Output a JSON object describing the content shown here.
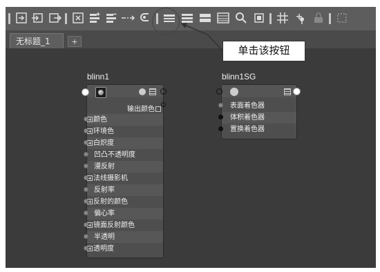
{
  "toolbar": {
    "icons": [
      "frame-icon",
      "graph-input-icon",
      "graph-output-icon",
      "clear-graph-icon",
      "add-selected-icon",
      "remove-selected-icon",
      "connect-icon",
      "rearrange-icon",
      "simple-mode-icon",
      "connected-mode-icon",
      "full-mode-icon",
      "custom-mode-icon",
      "search-icon",
      "snapshot-icon",
      "grid-icon",
      "snap-icon",
      "lock-icon",
      "extra-icon"
    ]
  },
  "tabs": {
    "active": "无标题_1",
    "add": "+"
  },
  "nodes": {
    "blinn1": {
      "title": "blinn1",
      "output_label": "输出颜色",
      "attrs": [
        "颜色",
        "环境色",
        "白炽度",
        "凹凸不透明度",
        "漫反射",
        "法线摄影机",
        "反射率",
        "反射的颜色",
        "偏心率",
        "镜面反射颜色",
        "半透明",
        "透明度"
      ]
    },
    "blinn1SG": {
      "title": "blinn1SG",
      "attrs": [
        "表面着色器",
        "体积着色器",
        "置换着色器"
      ]
    }
  },
  "callout": {
    "text": "单击该按钮"
  }
}
